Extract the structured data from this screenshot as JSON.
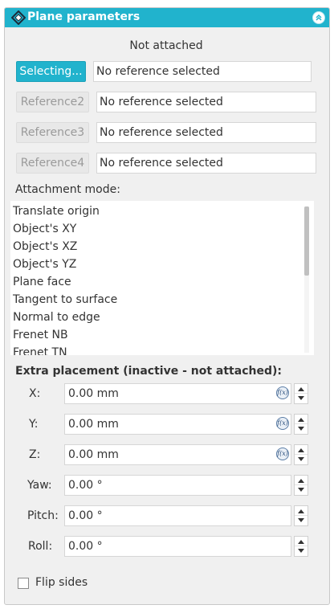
{
  "panel": {
    "title": "Plane parameters",
    "header_color": "#21b3cd"
  },
  "status": "Not attached",
  "references": [
    {
      "button_label": "Selecting...",
      "value": "No reference selected",
      "active": true
    },
    {
      "button_label": "Reference2",
      "value": "No reference selected",
      "active": false
    },
    {
      "button_label": "Reference3",
      "value": "No reference selected",
      "active": false
    },
    {
      "button_label": "Reference4",
      "value": "No reference selected",
      "active": false
    }
  ],
  "attachment_mode": {
    "label": "Attachment mode:",
    "items": [
      "Translate origin",
      "Object's XY",
      "Object's XZ",
      "Object's  YZ",
      "Plane face",
      "Tangent to surface",
      "Normal to edge",
      "Frenet NB",
      "Frenet TN"
    ]
  },
  "extra_placement": {
    "label": "Extra placement (inactive - not attached):",
    "fields": [
      {
        "label": "X:",
        "value": "0.00 mm",
        "has_expression": true
      },
      {
        "label": "Y:",
        "value": "0.00 mm",
        "has_expression": true
      },
      {
        "label": "Z:",
        "value": "0.00 mm",
        "has_expression": true
      },
      {
        "label": "Yaw:",
        "value": "0.00 °",
        "has_expression": false
      },
      {
        "label": "Pitch:",
        "value": "0.00 °",
        "has_expression": false
      },
      {
        "label": "Roll:",
        "value": "0.00 °",
        "has_expression": false
      }
    ],
    "expression_icon": "f(x)"
  },
  "flip_sides": {
    "label": "Flip sides",
    "checked": false
  }
}
